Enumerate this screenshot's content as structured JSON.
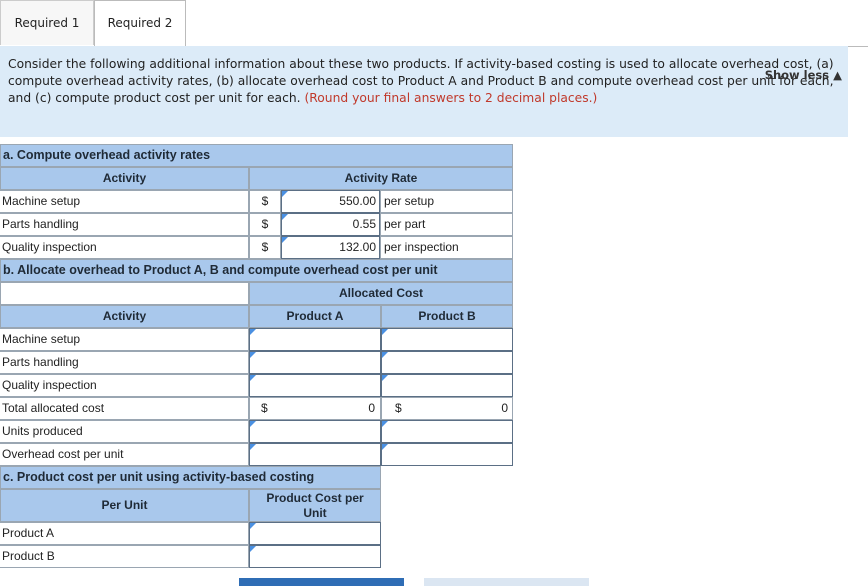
{
  "tabs": [
    "Required 1",
    "Required 2"
  ],
  "instructions": {
    "text": "Consider the following additional information about these two products. If activity-based costing is used to allocate overhead cost, (a) compute overhead activity rates, (b) allocate overhead cost to Product A and Product B and compute overhead cost per unit for each, and (c) compute product cost per unit for each.",
    "note": "(Round your final answers to 2 decimal places.)",
    "toggle": "Show less"
  },
  "section_a": {
    "title": "a. Compute overhead activity rates",
    "col_activity": "Activity",
    "col_rate": "Activity Rate",
    "rows": [
      {
        "label": "Machine setup",
        "currency": "$",
        "rate": "550.00",
        "unit": "per setup"
      },
      {
        "label": "Parts handling",
        "currency": "$",
        "rate": "0.55",
        "unit": "per part"
      },
      {
        "label": "Quality inspection",
        "currency": "$",
        "rate": "132.00",
        "unit": "per inspection"
      }
    ]
  },
  "section_b": {
    "title": "b. Allocate overhead to Product A, B and compute overhead cost per unit",
    "group_header": "Allocated Cost",
    "col_activity": "Activity",
    "col_a": "Product A",
    "col_b": "Product B",
    "rows": [
      "Machine setup",
      "Parts handling",
      "Quality inspection"
    ],
    "total_label": "Total allocated cost",
    "total_currency": "$",
    "total_a": "0",
    "total_b": "0",
    "units_label": "Units produced",
    "ohpu_label": "Overhead cost per unit"
  },
  "section_c": {
    "title": "c. Product cost per unit using activity-based costing",
    "col_per_unit": "Per Unit",
    "col_cost": "Product Cost per Unit",
    "rows": [
      "Product A",
      "Product B"
    ]
  }
}
